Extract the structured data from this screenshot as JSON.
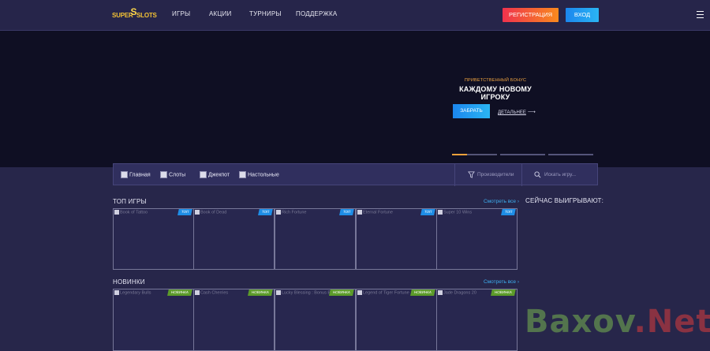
{
  "header": {
    "logo_left": "SUPER",
    "logo_mid": "S",
    "logo_right": "SLOTS",
    "nav": [
      "ИГРЫ",
      "АКЦИИ",
      "ТУРНИРЫ",
      "ПОДДЕРЖКА"
    ],
    "register_label": "РЕГИСТРАЦИЯ",
    "login_label": "ВХОД",
    "menu_icon": "hamburger-icon"
  },
  "hero": {
    "kicker": "ПРИВЕТСТВЕННЫЙ БОНУС",
    "headline_line1": "КАЖДОМУ НОВОМУ",
    "headline_line2": "ИГРОКУ",
    "take_label": "ЗАБРАТЬ",
    "details_label": "ДЕТАЛЬНЕЕ",
    "slides": 3,
    "active_slide": 1,
    "active_progress": 0.33
  },
  "filters": {
    "tabs": [
      "Главная",
      "Слоты",
      "Джекпот",
      "Настольные"
    ],
    "providers_placeholder": "Производители",
    "search_placeholder": "Искать игру..."
  },
  "top_games": {
    "title": "ТОП ИГРЫ",
    "see_all": "Смотреть все",
    "badge": "ТОП",
    "cards": [
      "Book of Tattoo",
      "Book of Dead",
      "Rich Fortune",
      "Eternal Fortune",
      "Super 10 Wins"
    ]
  },
  "new_games": {
    "title": "НОВИНКИ",
    "see_all": "Смотреть все",
    "badge": "НОВИНКА",
    "cards": [
      "Legendary Bulls",
      "Cash Cherries",
      "Lucky Blessing : Bonus Buy",
      "Legend of Tiger Fortune",
      "Jade Dragons 20"
    ]
  },
  "winners_title": "СЕЙЧАС ВЫИГРЫВАЮТ:",
  "watermark": {
    "part1": "Baxov",
    "part2": ".Net"
  },
  "colors": {
    "accent_orange": "#f88a1e",
    "accent_blue": "#2bb5f3",
    "badge_top": "#1e8de6",
    "badge_new": "#5c9b2a"
  }
}
